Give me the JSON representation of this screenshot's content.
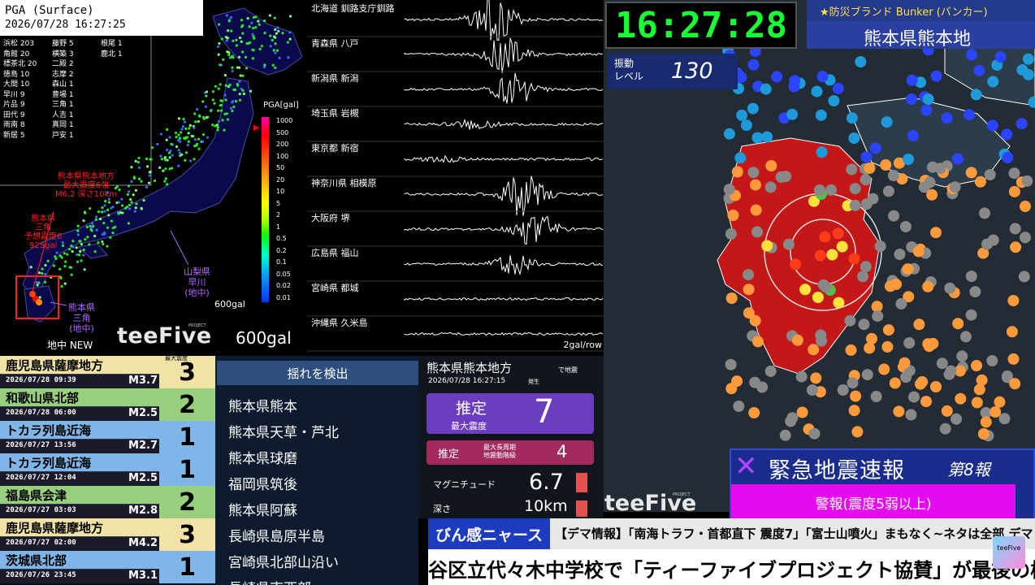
{
  "pga": {
    "title": "PGA (Surface)",
    "datetime": "2026/07/28 16:27:25",
    "stations": [
      "浜松 203",
      "角館 20",
      "標茶北 20",
      "徳島 10",
      "大間 10",
      "早川 9",
      "片品 9",
      "田代 9",
      "雨南 8",
      "新居 5",
      "藤野 5",
      "横築 3",
      "二殿 2",
      "志摩 2",
      "森山 1",
      "豊場 1",
      "三角 1",
      "人吉 1",
      "真岡 1",
      "戸安 1",
      "根尾 1",
      "鹿北 1"
    ],
    "epicenter_note": "熊本県熊本地方\n最大震度6強\nM6.2 深さ10km",
    "max_note": "熊本県\n三角\n予想震度6\n925gal",
    "station_note_right": "山梨県\n早川\n(地中)",
    "station_note_left": "熊本県\n三角\n(地中)",
    "scale_small": "600gal",
    "scale_big": "600gal",
    "logo": "teeFive",
    "logo_sub": "PROJECT",
    "underground_label": "地中 NEW",
    "scale_title": "PGA[gal]",
    "scale_labels": [
      "1000",
      "500",
      "200",
      "100",
      "50",
      "20",
      "10",
      "5",
      "2",
      "1",
      "0.5",
      "0.2",
      "0.1",
      "0.05",
      "0.02",
      "0.01"
    ]
  },
  "waves": {
    "stations": [
      "北海道 釧路支庁釧路",
      "青森県 八戸",
      "新潟県 新潟",
      "埼玉県 岩槻",
      "東京都 新宿",
      "神奈川県 相模原",
      "大阪府 堺",
      "広島県 福山",
      "宮崎県 都城",
      "沖縄県 久米島"
    ],
    "unit": "2gal/row"
  },
  "clock": "16:27:28",
  "brand": "★防災ブランド Bunker (バンカー)",
  "region_head": "熊本県熊本地方",
  "level": {
    "label": "振動\nレベル",
    "value": "130"
  },
  "eew": {
    "title": "緊急地震速報",
    "count": "第8報",
    "warning": "警報(震度5弱以上)"
  },
  "history": [
    {
      "name": "鹿児島県薩摩地方",
      "time": "2026/07/28 09:39",
      "mag": "M3.7",
      "int": "3",
      "color": "#f1e3a6"
    },
    {
      "name": "和歌山県北部",
      "time": "2026/07/28 06:00",
      "mag": "M2.5",
      "int": "2",
      "color": "#97cf7f"
    },
    {
      "name": "トカラ列島近海",
      "time": "2026/07/27 13:56",
      "mag": "M2.7",
      "int": "1",
      "color": "#7fb5e8"
    },
    {
      "name": "トカラ列島近海",
      "time": "2026/07/27 12:04",
      "mag": "M2.5",
      "int": "1",
      "color": "#7fb5e8"
    },
    {
      "name": "福島県会津",
      "time": "2026/07/27 03:03",
      "mag": "M2.8",
      "int": "2",
      "color": "#97cf7f"
    },
    {
      "name": "鹿児島県薩摩地方",
      "time": "2026/07/27 02:00",
      "mag": "M4.2",
      "int": "3",
      "color": "#f1e3a6"
    },
    {
      "name": "茨城県北部",
      "time": "2026/07/26 23:45",
      "mag": "M3.1",
      "int": "1",
      "color": "#7fb5e8"
    }
  ],
  "history_header": "最大震度",
  "detect": {
    "head": "揺れを検出",
    "items": [
      "熊本県熊本",
      "熊本県天草・芦北",
      "熊本県球磨",
      "福岡県筑後",
      "熊本県阿蘇",
      "長崎県島原半島",
      "宮崎県北部山沿い",
      "長崎県南西部"
    ]
  },
  "info": {
    "region": "熊本県熊本地方",
    "region_sub": "で地震",
    "time": "2026/07/28  16:27:15",
    "time_sub": "発生",
    "est_label": "推定",
    "est_sub": "最大震度",
    "est_value": "7",
    "lp_label": "推定",
    "lp_sub": "最大長周期\n地震動階級",
    "lp_value": "4",
    "mag_label": "マグニチュード",
    "mag_value": "6.7",
    "depth_label": "深さ",
    "depth_value": "10km"
  },
  "ticker": {
    "label": "びん感ニャース",
    "text": "【デマ情報】「南海トラフ・首都直下 震度7」「富士山噴火」まもなく~ネタは全部 デマ"
  },
  "news_text": "谷区立代々木中学校で「ティーファイブプロジェクト協賛」が最後の校舎",
  "corner_badge": "teeFive"
}
